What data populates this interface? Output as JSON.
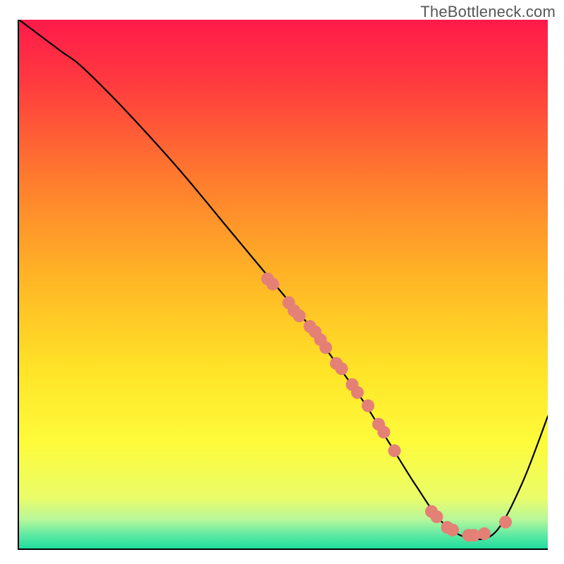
{
  "watermark": "TheBottleneck.com",
  "chart_data": {
    "type": "line",
    "title": "",
    "xlabel": "",
    "ylabel": "",
    "xlim": [
      0,
      100
    ],
    "ylim": [
      0,
      100
    ],
    "grid": false,
    "legend": false,
    "series": [
      {
        "name": "bottleneck-curve",
        "type": "line",
        "color": "#000000",
        "x": [
          0,
          4,
          8,
          12,
          20,
          30,
          40,
          45,
          50,
          55,
          60,
          65,
          70,
          75,
          80,
          85,
          90,
          95,
          100
        ],
        "y": [
          100,
          97,
          94,
          91,
          83,
          72,
          60,
          54,
          48,
          42,
          35,
          28,
          20,
          12,
          5,
          2,
          3,
          12,
          25
        ]
      },
      {
        "name": "curve-markers",
        "type": "scatter",
        "color": "#e48076",
        "marker_radius": 9,
        "points": [
          {
            "x": 47,
            "y": 51
          },
          {
            "x": 48,
            "y": 50
          },
          {
            "x": 51,
            "y": 46.5
          },
          {
            "x": 52,
            "y": 45
          },
          {
            "x": 53,
            "y": 44
          },
          {
            "x": 55,
            "y": 42
          },
          {
            "x": 56,
            "y": 41
          },
          {
            "x": 57,
            "y": 39.5
          },
          {
            "x": 58,
            "y": 38
          },
          {
            "x": 60,
            "y": 35
          },
          {
            "x": 61,
            "y": 34
          },
          {
            "x": 63,
            "y": 31
          },
          {
            "x": 64,
            "y": 29.5
          },
          {
            "x": 66,
            "y": 27
          },
          {
            "x": 68,
            "y": 23.5
          },
          {
            "x": 69,
            "y": 22
          },
          {
            "x": 71,
            "y": 18.5
          },
          {
            "x": 78,
            "y": 7
          },
          {
            "x": 79,
            "y": 6
          },
          {
            "x": 81,
            "y": 4
          },
          {
            "x": 82,
            "y": 3.5
          },
          {
            "x": 85,
            "y": 2.5
          },
          {
            "x": 86,
            "y": 2.5
          },
          {
            "x": 88,
            "y": 2.8
          },
          {
            "x": 92,
            "y": 5
          }
        ]
      }
    ],
    "background_gradient": {
      "stops": [
        {
          "offset": 0.0,
          "color": "#ff1a4a"
        },
        {
          "offset": 0.12,
          "color": "#ff3b3f"
        },
        {
          "offset": 0.3,
          "color": "#ff7b2e"
        },
        {
          "offset": 0.48,
          "color": "#ffb326"
        },
        {
          "offset": 0.66,
          "color": "#ffe327"
        },
        {
          "offset": 0.8,
          "color": "#fdfb3a"
        },
        {
          "offset": 0.905,
          "color": "#eafc6a"
        },
        {
          "offset": 0.945,
          "color": "#b7f79a"
        },
        {
          "offset": 0.975,
          "color": "#5de9a4"
        },
        {
          "offset": 1.0,
          "color": "#1fdc9c"
        }
      ]
    }
  }
}
